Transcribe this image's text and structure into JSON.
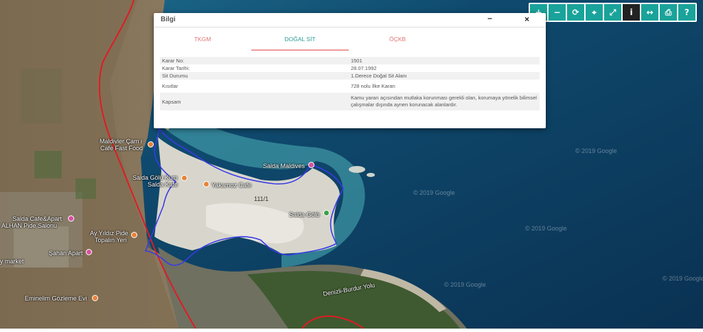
{
  "map": {
    "labels": {
      "maldivler_cam": "Maldivler Çam i",
      "cafe_fast_food": "Cafe Fast Food",
      "salda_gol_kum": "Salda Gölü Kum",
      "salda_kafe": "Salda Kafe",
      "yakamoz_cafe": "Yakamoz Cafe",
      "salda_maldives": "Salda Maldives",
      "parcel": "111/1",
      "salda_golu": "Salda Gölü",
      "salda_cafe_apart": "Salda Cafe&Apart",
      "alhan_pide": "ALHAN Pide Salonu",
      "ay_yildiz": "Ay Yıldız Pide",
      "topalin_yeri": "Topalın Yeri",
      "sahan_apart": "Şahan Apart",
      "market": "y market",
      "eminelim": "Eminelim Gözleme Evi",
      "road": "Denizli-Burdur Yolu"
    },
    "watermark": "© 2019 Google",
    "colors": {
      "boundary": "#e01b24",
      "protected_area": "#3a3ae8",
      "water": "#0d3a5c",
      "poi_orange": "#e8833a",
      "poi_pink": "#d94fa0",
      "poi_green": "#3aa04a"
    }
  },
  "toolbar": {
    "buttons": [
      {
        "name": "zoom-in-icon",
        "glyph": "+"
      },
      {
        "name": "zoom-out-icon",
        "glyph": "−"
      },
      {
        "name": "refresh-icon",
        "glyph": "⟳"
      },
      {
        "name": "locate-icon",
        "glyph": "⌖"
      },
      {
        "name": "fullscreen-icon",
        "glyph": "⤢"
      },
      {
        "name": "info-icon",
        "glyph": "i"
      },
      {
        "name": "measure-icon",
        "glyph": "↔"
      },
      {
        "name": "print-icon",
        "glyph": "⎙"
      },
      {
        "name": "help-icon",
        "glyph": "?"
      }
    ],
    "active": "info-icon"
  },
  "panel": {
    "title": "Bilgi",
    "minimize": "−",
    "close": "×",
    "tabs": [
      "TKGM",
      "DOĞAL SİT",
      "ÖÇKB"
    ],
    "active_tab": "DOĞAL SİT",
    "rows": [
      {
        "key": "Karar No:",
        "value": "1501"
      },
      {
        "key": "Karar Tarihi:",
        "value": "28.07.1992"
      },
      {
        "key": "Sit Durumu",
        "value": "1.Derece Doğal Sit Alanı"
      },
      {
        "key": "Kısıtlar",
        "value": "728 nolu İlke Kararı"
      },
      {
        "key": "Kapsam",
        "value": "Kamu yararı açısından mutlaka korunması gerekli olan, korumaya yönelik bilimsel çalışmalar dışında aynen korunacak alanlardır."
      }
    ]
  }
}
